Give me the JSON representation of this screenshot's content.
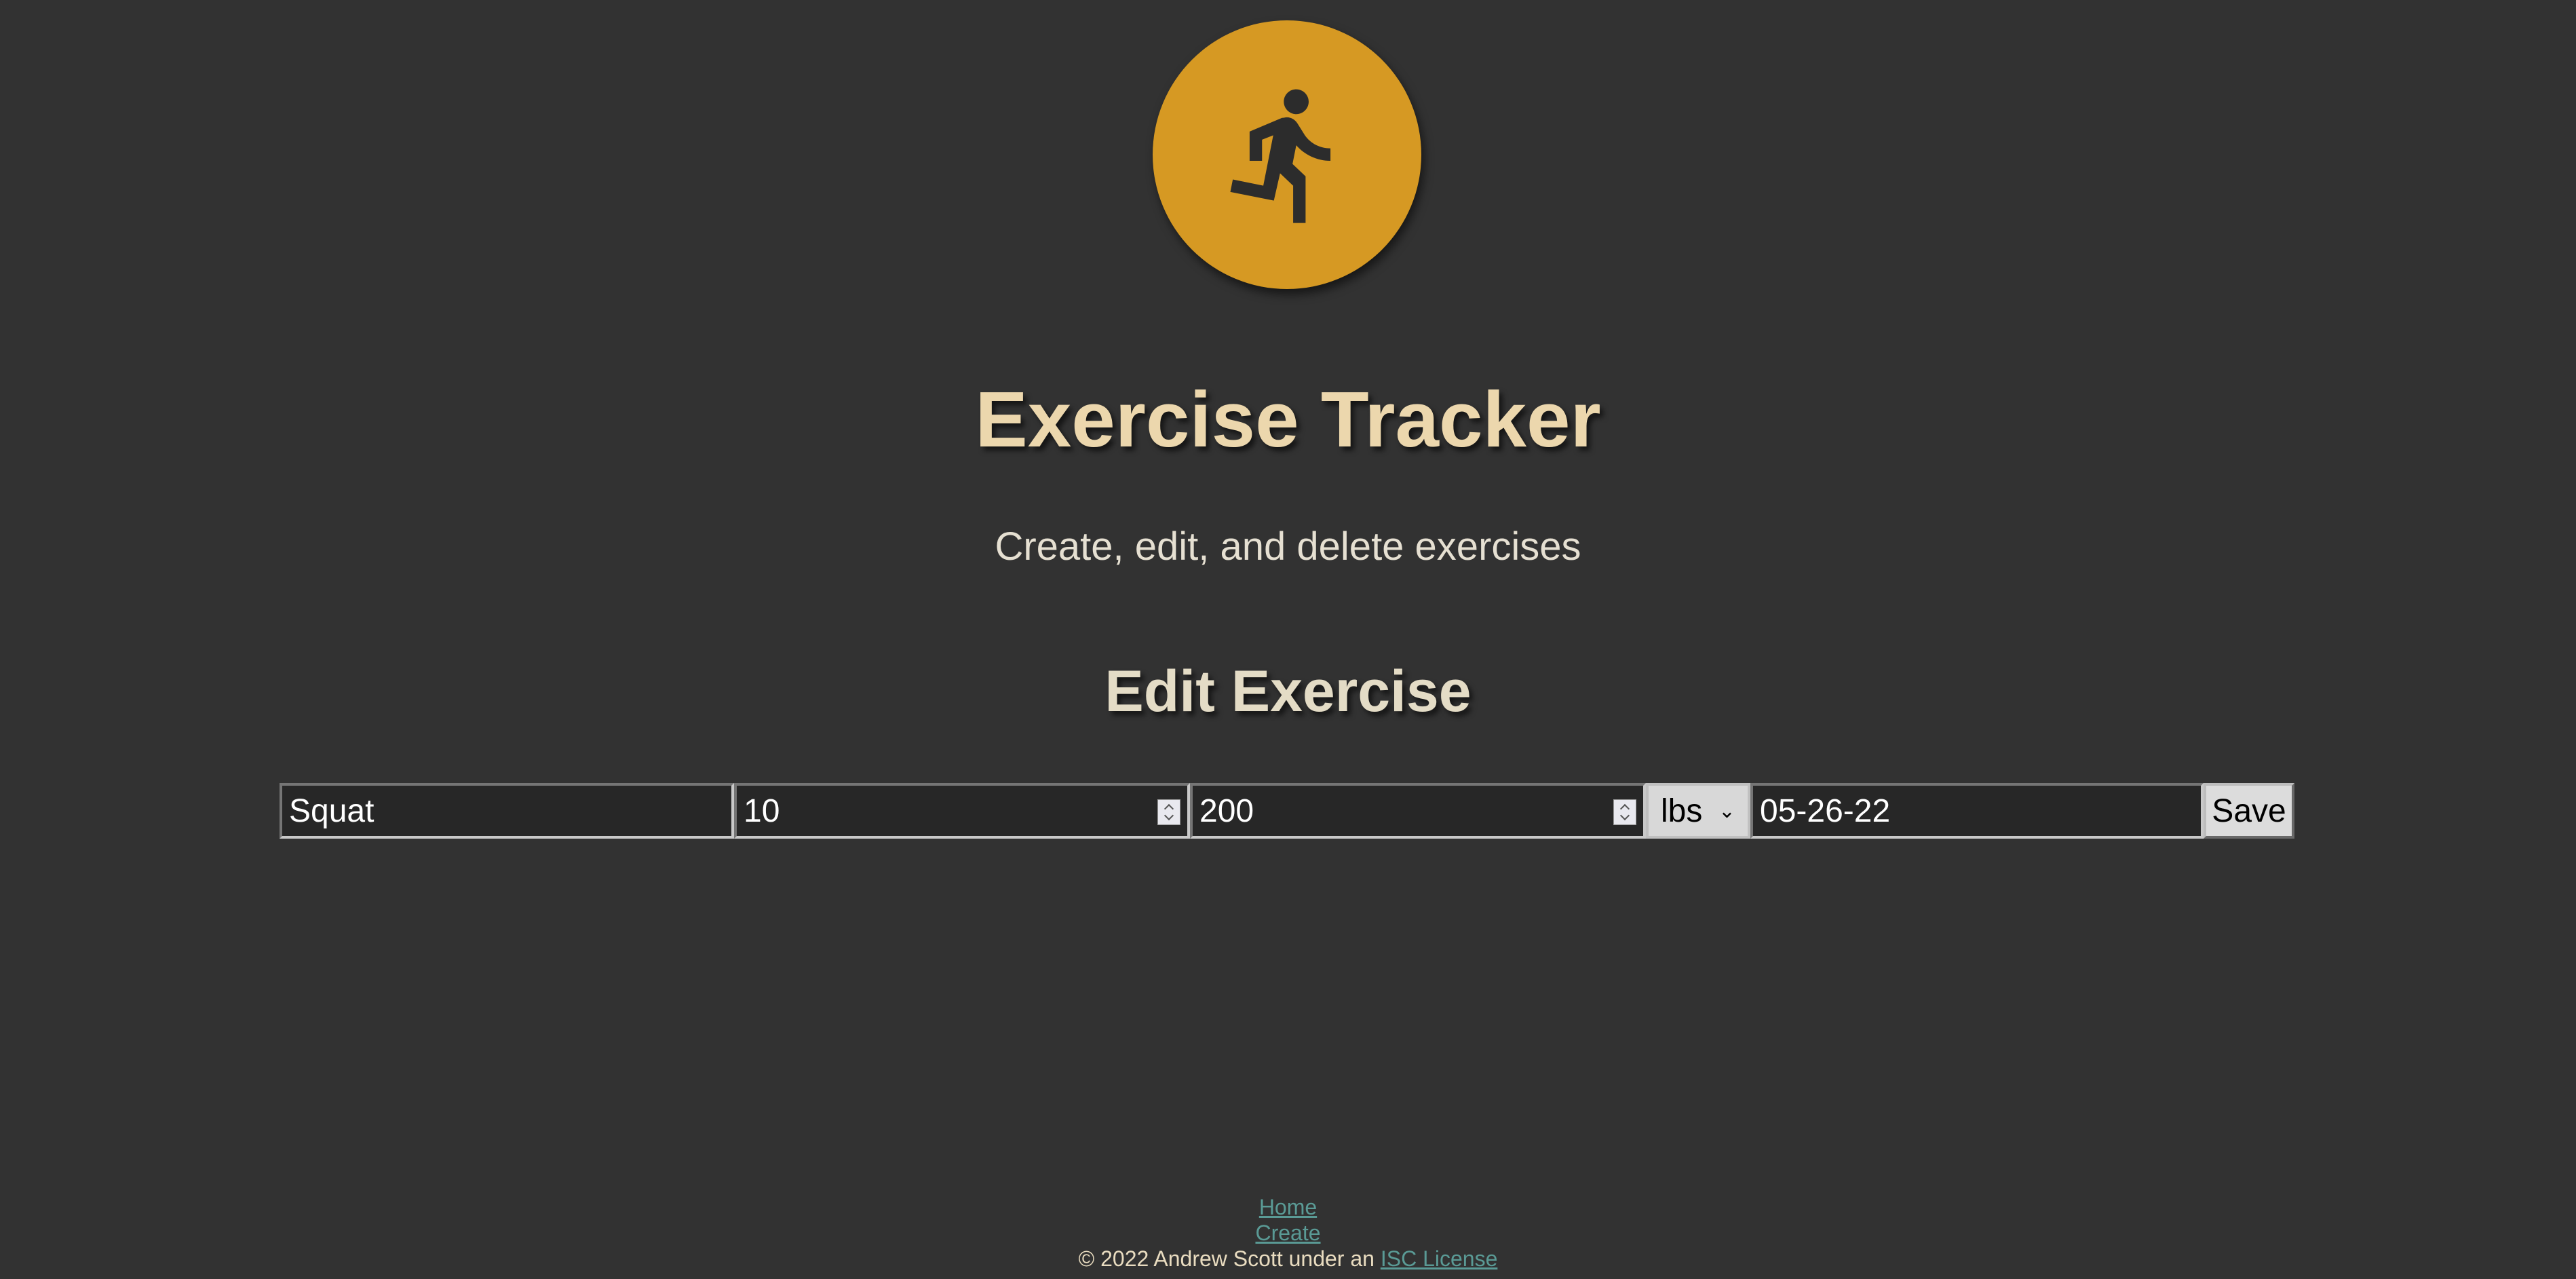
{
  "header": {
    "logo_icon": "running-person-icon",
    "logo_color": "#d69923",
    "title": "Exercise Tracker",
    "subtitle": "Create, edit, and delete exercises"
  },
  "main": {
    "heading": "Edit Exercise",
    "form": {
      "name": "Squat",
      "reps": "10",
      "weight": "200",
      "unit": "lbs",
      "date": "05-26-22",
      "save_label": "Save"
    }
  },
  "footer": {
    "nav": {
      "home": "Home",
      "create": "Create"
    },
    "copyright": "© 2022 Andrew Scott under an",
    "license_link": "ISC License",
    "link_color": "#5a9a95"
  }
}
